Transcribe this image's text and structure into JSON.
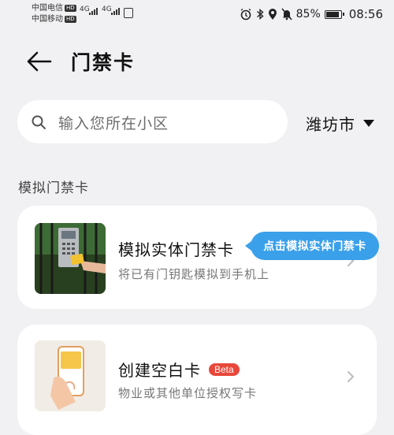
{
  "status_bar": {
    "carrier1": "中国电信",
    "carrier2": "中国移动",
    "hd": "HD",
    "net1": "4G",
    "net2": "4G",
    "battery": "85%",
    "time": "08:56"
  },
  "header": {
    "title": "门禁卡"
  },
  "search": {
    "placeholder": "输入您所在小区",
    "city": "潍坊市"
  },
  "section": {
    "title": "模拟门禁卡"
  },
  "cards": [
    {
      "title": "模拟实体门禁卡",
      "subtitle": "将已有门钥匙模拟到手机上"
    },
    {
      "title": "创建空白卡",
      "badge": "Beta",
      "subtitle": "物业或其他单位授权写卡"
    }
  ],
  "tooltip": {
    "text": "点击模拟实体门禁卡"
  },
  "colors": {
    "background": "#f1f1f3",
    "accent_tooltip": "#3aa0ea",
    "badge": "#e8483b"
  }
}
